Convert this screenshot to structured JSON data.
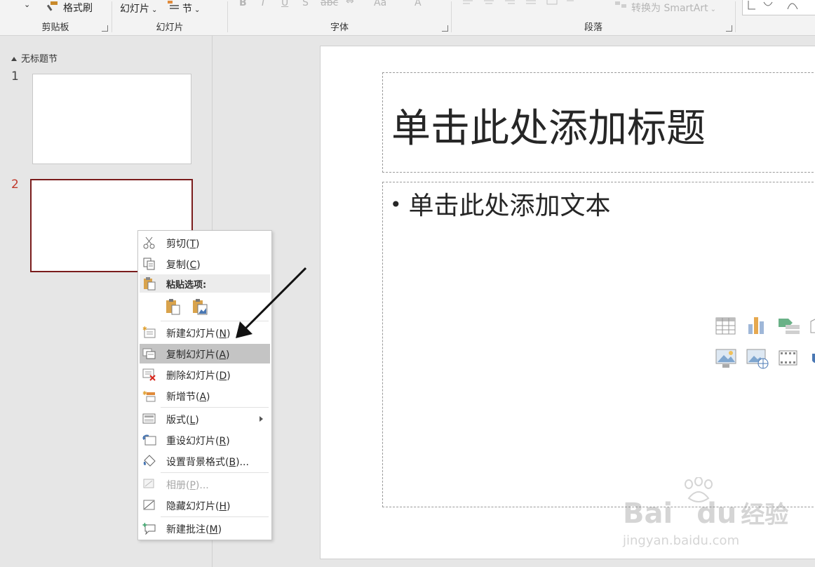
{
  "ribbon": {
    "clipboard": {
      "format_painter": "格式刷",
      "group_label": "剪贴板"
    },
    "slides": {
      "slide_button": "幻灯片",
      "section_button": "节",
      "group_label": "幻灯片"
    },
    "font": {
      "group_label": "字体",
      "bold": "B",
      "italic": "I",
      "underline": "U",
      "shadow": "S",
      "strike": "abc",
      "case": "Aa",
      "color": "A"
    },
    "paragraph": {
      "group_label": "段落",
      "smartart": "转换为 SmartArt"
    }
  },
  "panel": {
    "section_title": "无标题节",
    "slides": [
      {
        "number": "1"
      },
      {
        "number": "2"
      }
    ]
  },
  "slide": {
    "title_placeholder": "单击此处添加标题",
    "body_placeholder": "单击此处添加文本",
    "bullet": "•"
  },
  "context_menu": {
    "items": [
      {
        "label": "剪切(",
        "key": "T",
        "end": ")"
      },
      {
        "label": "复制(",
        "key": "C",
        "end": ")"
      },
      {
        "label": "粘贴选项:"
      },
      {
        "label": "新建幻灯片(",
        "key": "N",
        "end": ")"
      },
      {
        "label": "复制幻灯片(",
        "key": "A",
        "end": ")"
      },
      {
        "label": "删除幻灯片(",
        "key": "D",
        "end": ")"
      },
      {
        "label": "新增节(",
        "key": "A",
        "end": ")"
      },
      {
        "label": "版式(",
        "key": "L",
        "end": ")"
      },
      {
        "label": "重设幻灯片(",
        "key": "R",
        "end": ")"
      },
      {
        "label": "设置背景格式(",
        "key": "B",
        "end": ")..."
      },
      {
        "label": "相册(",
        "key": "P",
        "end": ")..."
      },
      {
        "label": "隐藏幻灯片(",
        "key": "H",
        "end": ")"
      },
      {
        "label": "新建批注(",
        "key": "M",
        "end": ")"
      }
    ]
  },
  "watermark": {
    "brand": "Bai",
    "brand2": "du",
    "cn": "经验",
    "url": "jingyan.baidu.com"
  },
  "colors": {
    "selected_thumb_border": "#7a1c1c",
    "slide_num_selected": "#c0392b",
    "menu_highlight": "#c4c4c4",
    "delete_x": "#d9261c"
  }
}
